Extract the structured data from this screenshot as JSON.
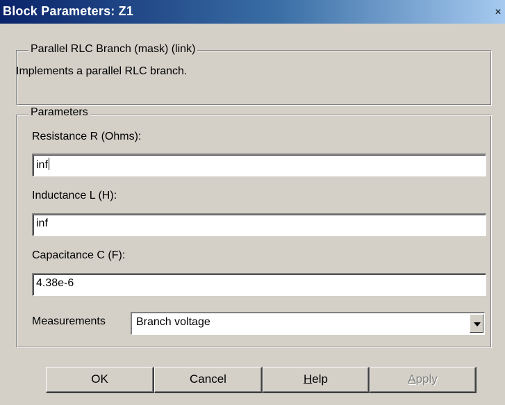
{
  "window": {
    "title": "Block Parameters: Z1",
    "close_glyph": "×"
  },
  "mask_group": {
    "legend": "Parallel RLC Branch (mask) (link)",
    "description": "Implements a parallel RLC branch."
  },
  "parameters": {
    "legend": "Parameters",
    "resistance": {
      "label": "Resistance R (Ohms):",
      "value": "inf"
    },
    "inductance": {
      "label": "Inductance L (H):",
      "value": "inf"
    },
    "capacitance": {
      "label": "Capacitance C (F):",
      "value": "4.38e-6"
    },
    "measurements": {
      "label": "Measurements",
      "selected": "Branch voltage"
    }
  },
  "buttons": {
    "ok": "OK",
    "cancel": "Cancel",
    "help_first": "H",
    "help_rest": "elp",
    "apply_first": "A",
    "apply_rest": "pply"
  },
  "colors": {
    "titlebar_start": "#0a246a",
    "titlebar_end": "#a6caf0",
    "face": "#d4d0c8"
  }
}
